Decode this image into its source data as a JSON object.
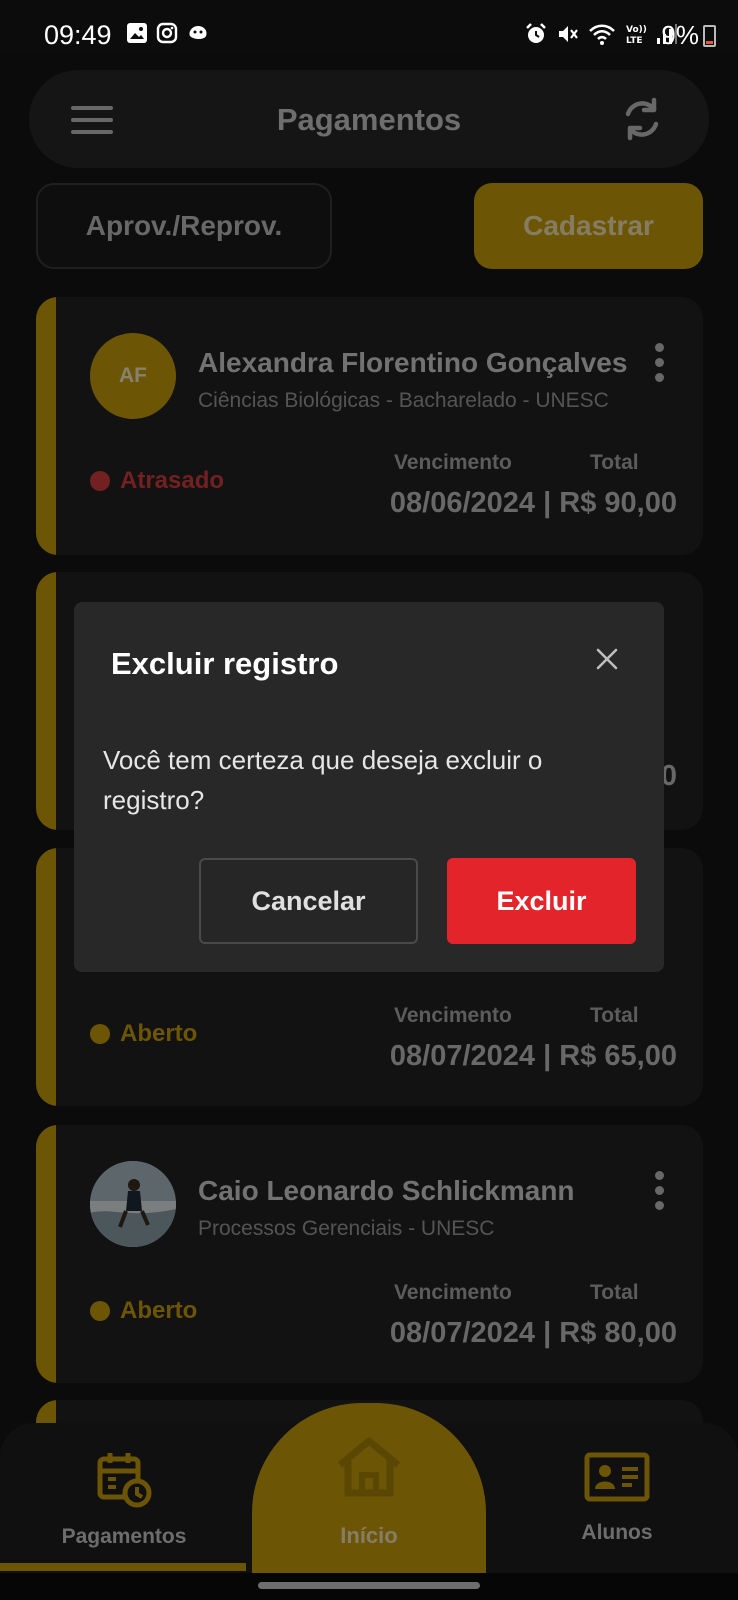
{
  "status_bar": {
    "time": "09:49",
    "battery": "9%"
  },
  "header": {
    "title": "Pagamentos"
  },
  "actions": {
    "approve_label": "Aprov./Reprov.",
    "register_label": "Cadastrar"
  },
  "cards": [
    {
      "initials": "AF",
      "name": "Alexandra Florentino Gonçalves",
      "course": "Ciências Biológicas - Bacharelado - UNESC",
      "status": "Atrasado",
      "status_color": "#d23b3b",
      "due_label": "Vencimento",
      "total_label": "Total",
      "value": "08/06/2024 | R$ 90,00"
    },
    {
      "partial_value": "0"
    },
    {
      "status": "Aberto",
      "status_color": "#c79c0c",
      "due_label": "Vencimento",
      "total_label": "Total",
      "value": "08/07/2024 | R$ 65,00"
    },
    {
      "name": "Caio Leonardo Schlickmann",
      "course": "Processos Gerenciais - UNESC",
      "status": "Aberto",
      "status_color": "#c79c0c",
      "due_label": "Vencimento",
      "total_label": "Total",
      "value": "08/07/2024 | R$ 80,00"
    }
  ],
  "dialog": {
    "title": "Excluir registro",
    "message": "Você tem certeza que deseja excluir o registro?",
    "cancel_label": "Cancelar",
    "delete_label": "Excluir"
  },
  "nav": {
    "payments_label": "Pagamentos",
    "home_label": "Início",
    "students_label": "Alunos"
  },
  "colors": {
    "accent": "#c79c0c",
    "danger": "#e3242b",
    "background": "#151515"
  }
}
